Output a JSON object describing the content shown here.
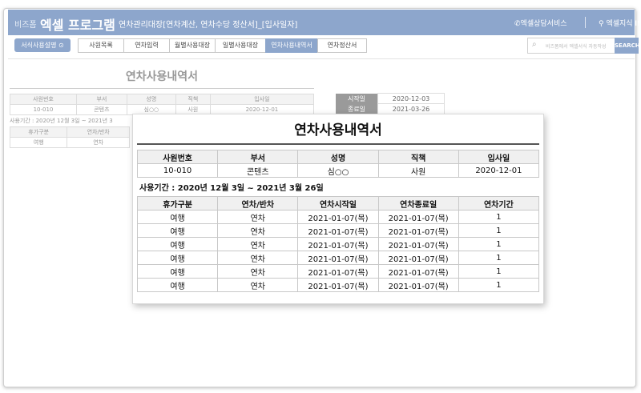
{
  "header": {
    "brand_small": "비즈폼",
    "brand_big": "엑셀 프로그램",
    "title": "연차관리대장[연차계산, 연차수당 정산서]_[입사일자]",
    "consult": "엑셀상담서비스",
    "knowledge": "엑셀지식 IN"
  },
  "toolbar": {
    "guide_label": "서식사용설명",
    "tabs": [
      "사원목록",
      "연차입력",
      "월별사용대장",
      "일별사용대장",
      "연차사용내역서",
      "연차정산서"
    ],
    "search_placeholder": "비즈폼에서 엑셀서식 자동작성",
    "search_label": "SEARCH"
  },
  "report": {
    "title": "연차사용내역서",
    "emp_headers": [
      "사원번호",
      "부서",
      "성명",
      "직책",
      "입사일"
    ],
    "emp_values": [
      "10-010",
      "콘텐츠",
      "심○○",
      "사원",
      "2020-12-01"
    ],
    "period": "사용기간 : 2020년 12월 3일 ~ 2021년 3월 26일",
    "period_short": "사용기간 : 2020년 12월 3일 ~ 2021년 3",
    "leave_headers": [
      "휴가구분",
      "연차/반차",
      "연차시작일",
      "연차종료일",
      "연차기간"
    ],
    "rows": [
      [
        "여행",
        "연차",
        "2021-01-07(목)",
        "2021-01-07(목)",
        "1"
      ],
      [
        "여행",
        "연차",
        "2021-01-07(목)",
        "2021-01-07(목)",
        "1"
      ],
      [
        "여행",
        "연차",
        "2021-01-07(목)",
        "2021-01-07(목)",
        "1"
      ],
      [
        "여행",
        "연차",
        "2021-01-07(목)",
        "2021-01-07(목)",
        "1"
      ],
      [
        "여행",
        "연차",
        "2021-01-07(목)",
        "2021-01-07(목)",
        "1"
      ],
      [
        "여행",
        "연차",
        "2021-01-07(목)",
        "2021-01-07(목)",
        "1"
      ]
    ]
  },
  "side": {
    "start_label": "시작일",
    "start_value": "2020-12-03",
    "end_label": "종료일",
    "end_value": "2021-03-26"
  }
}
